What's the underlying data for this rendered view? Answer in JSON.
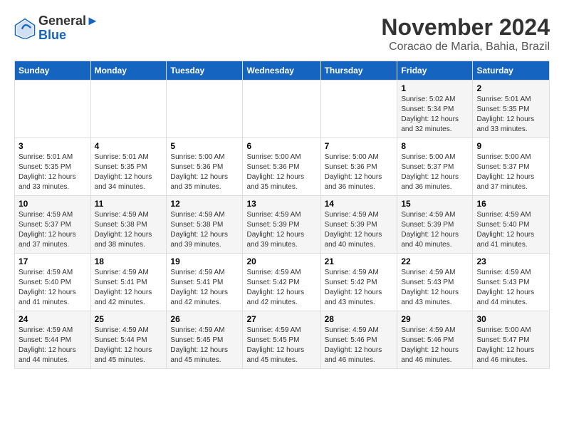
{
  "logo": {
    "line1": "General",
    "line2": "Blue"
  },
  "title": "November 2024",
  "location": "Coracao de Maria, Bahia, Brazil",
  "weekdays": [
    "Sunday",
    "Monday",
    "Tuesday",
    "Wednesday",
    "Thursday",
    "Friday",
    "Saturday"
  ],
  "weeks": [
    [
      {
        "day": "",
        "info": ""
      },
      {
        "day": "",
        "info": ""
      },
      {
        "day": "",
        "info": ""
      },
      {
        "day": "",
        "info": ""
      },
      {
        "day": "",
        "info": ""
      },
      {
        "day": "1",
        "info": "Sunrise: 5:02 AM\nSunset: 5:34 PM\nDaylight: 12 hours and 32 minutes."
      },
      {
        "day": "2",
        "info": "Sunrise: 5:01 AM\nSunset: 5:35 PM\nDaylight: 12 hours and 33 minutes."
      }
    ],
    [
      {
        "day": "3",
        "info": "Sunrise: 5:01 AM\nSunset: 5:35 PM\nDaylight: 12 hours and 33 minutes."
      },
      {
        "day": "4",
        "info": "Sunrise: 5:01 AM\nSunset: 5:35 PM\nDaylight: 12 hours and 34 minutes."
      },
      {
        "day": "5",
        "info": "Sunrise: 5:00 AM\nSunset: 5:36 PM\nDaylight: 12 hours and 35 minutes."
      },
      {
        "day": "6",
        "info": "Sunrise: 5:00 AM\nSunset: 5:36 PM\nDaylight: 12 hours and 35 minutes."
      },
      {
        "day": "7",
        "info": "Sunrise: 5:00 AM\nSunset: 5:36 PM\nDaylight: 12 hours and 36 minutes."
      },
      {
        "day": "8",
        "info": "Sunrise: 5:00 AM\nSunset: 5:37 PM\nDaylight: 12 hours and 36 minutes."
      },
      {
        "day": "9",
        "info": "Sunrise: 5:00 AM\nSunset: 5:37 PM\nDaylight: 12 hours and 37 minutes."
      }
    ],
    [
      {
        "day": "10",
        "info": "Sunrise: 4:59 AM\nSunset: 5:37 PM\nDaylight: 12 hours and 37 minutes."
      },
      {
        "day": "11",
        "info": "Sunrise: 4:59 AM\nSunset: 5:38 PM\nDaylight: 12 hours and 38 minutes."
      },
      {
        "day": "12",
        "info": "Sunrise: 4:59 AM\nSunset: 5:38 PM\nDaylight: 12 hours and 39 minutes."
      },
      {
        "day": "13",
        "info": "Sunrise: 4:59 AM\nSunset: 5:39 PM\nDaylight: 12 hours and 39 minutes."
      },
      {
        "day": "14",
        "info": "Sunrise: 4:59 AM\nSunset: 5:39 PM\nDaylight: 12 hours and 40 minutes."
      },
      {
        "day": "15",
        "info": "Sunrise: 4:59 AM\nSunset: 5:39 PM\nDaylight: 12 hours and 40 minutes."
      },
      {
        "day": "16",
        "info": "Sunrise: 4:59 AM\nSunset: 5:40 PM\nDaylight: 12 hours and 41 minutes."
      }
    ],
    [
      {
        "day": "17",
        "info": "Sunrise: 4:59 AM\nSunset: 5:40 PM\nDaylight: 12 hours and 41 minutes."
      },
      {
        "day": "18",
        "info": "Sunrise: 4:59 AM\nSunset: 5:41 PM\nDaylight: 12 hours and 42 minutes."
      },
      {
        "day": "19",
        "info": "Sunrise: 4:59 AM\nSunset: 5:41 PM\nDaylight: 12 hours and 42 minutes."
      },
      {
        "day": "20",
        "info": "Sunrise: 4:59 AM\nSunset: 5:42 PM\nDaylight: 12 hours and 42 minutes."
      },
      {
        "day": "21",
        "info": "Sunrise: 4:59 AM\nSunset: 5:42 PM\nDaylight: 12 hours and 43 minutes."
      },
      {
        "day": "22",
        "info": "Sunrise: 4:59 AM\nSunset: 5:43 PM\nDaylight: 12 hours and 43 minutes."
      },
      {
        "day": "23",
        "info": "Sunrise: 4:59 AM\nSunset: 5:43 PM\nDaylight: 12 hours and 44 minutes."
      }
    ],
    [
      {
        "day": "24",
        "info": "Sunrise: 4:59 AM\nSunset: 5:44 PM\nDaylight: 12 hours and 44 minutes."
      },
      {
        "day": "25",
        "info": "Sunrise: 4:59 AM\nSunset: 5:44 PM\nDaylight: 12 hours and 45 minutes."
      },
      {
        "day": "26",
        "info": "Sunrise: 4:59 AM\nSunset: 5:45 PM\nDaylight: 12 hours and 45 minutes."
      },
      {
        "day": "27",
        "info": "Sunrise: 4:59 AM\nSunset: 5:45 PM\nDaylight: 12 hours and 45 minutes."
      },
      {
        "day": "28",
        "info": "Sunrise: 4:59 AM\nSunset: 5:46 PM\nDaylight: 12 hours and 46 minutes."
      },
      {
        "day": "29",
        "info": "Sunrise: 4:59 AM\nSunset: 5:46 PM\nDaylight: 12 hours and 46 minutes."
      },
      {
        "day": "30",
        "info": "Sunrise: 5:00 AM\nSunset: 5:47 PM\nDaylight: 12 hours and 46 minutes."
      }
    ]
  ]
}
